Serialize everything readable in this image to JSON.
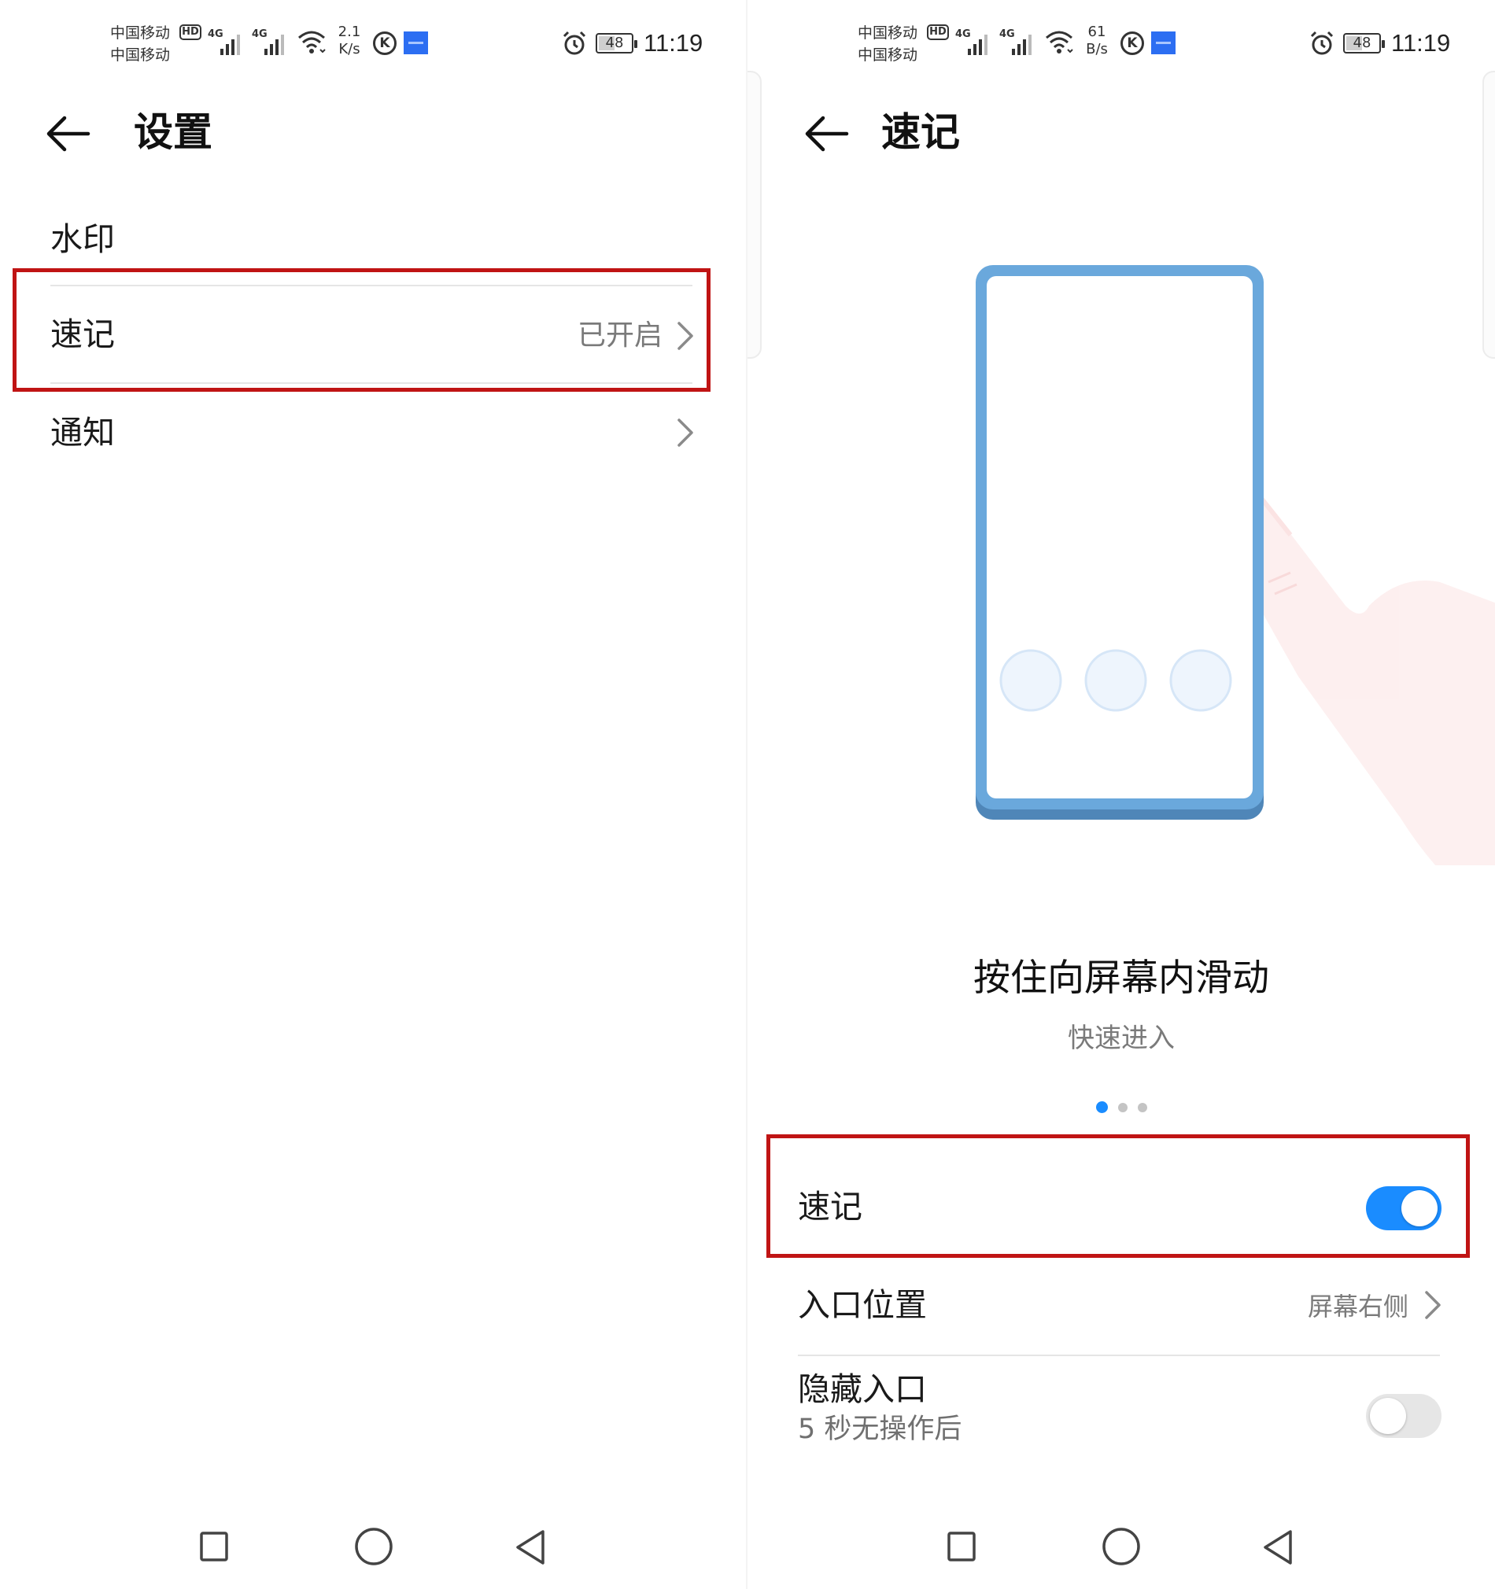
{
  "status_bar": {
    "carrier_1": "中国移动",
    "carrier_2": "中国移动",
    "hd": "HD",
    "network_1": "4G",
    "network_2": "4G",
    "left_speed_value": "2.1",
    "left_speed_unit": "K/s",
    "right_speed_value": "61",
    "right_speed_unit": "B/s",
    "k_badge": "K",
    "battery": "48",
    "time": "11:19"
  },
  "left_screen": {
    "title": "设置",
    "items": [
      {
        "label": "水印"
      },
      {
        "label": "速记",
        "value": "已开启"
      },
      {
        "label": "通知"
      }
    ]
  },
  "right_screen": {
    "title": "速记",
    "caption_title": "按住向屏幕内滑动",
    "caption_subtitle": "快速进入",
    "page_indicator": {
      "total": 3,
      "active": 1
    },
    "settings": [
      {
        "label": "速记",
        "toggle": true
      },
      {
        "label": "入口位置",
        "value": "屏幕右侧"
      },
      {
        "label": "隐藏入口",
        "sublabel": "5 秒无操作后",
        "toggle": false
      }
    ]
  },
  "icons": {
    "back": "arrow-left-icon",
    "chevron": "chevron-right-icon",
    "nav_recent": "square-icon",
    "nav_home": "circle-icon",
    "nav_back": "triangle-back-icon"
  },
  "colors": {
    "accent": "#1a8cff",
    "highlight_border": "#c01414",
    "phone_frame": "#6aa8dc",
    "secondary_text": "#7a7a7a"
  }
}
